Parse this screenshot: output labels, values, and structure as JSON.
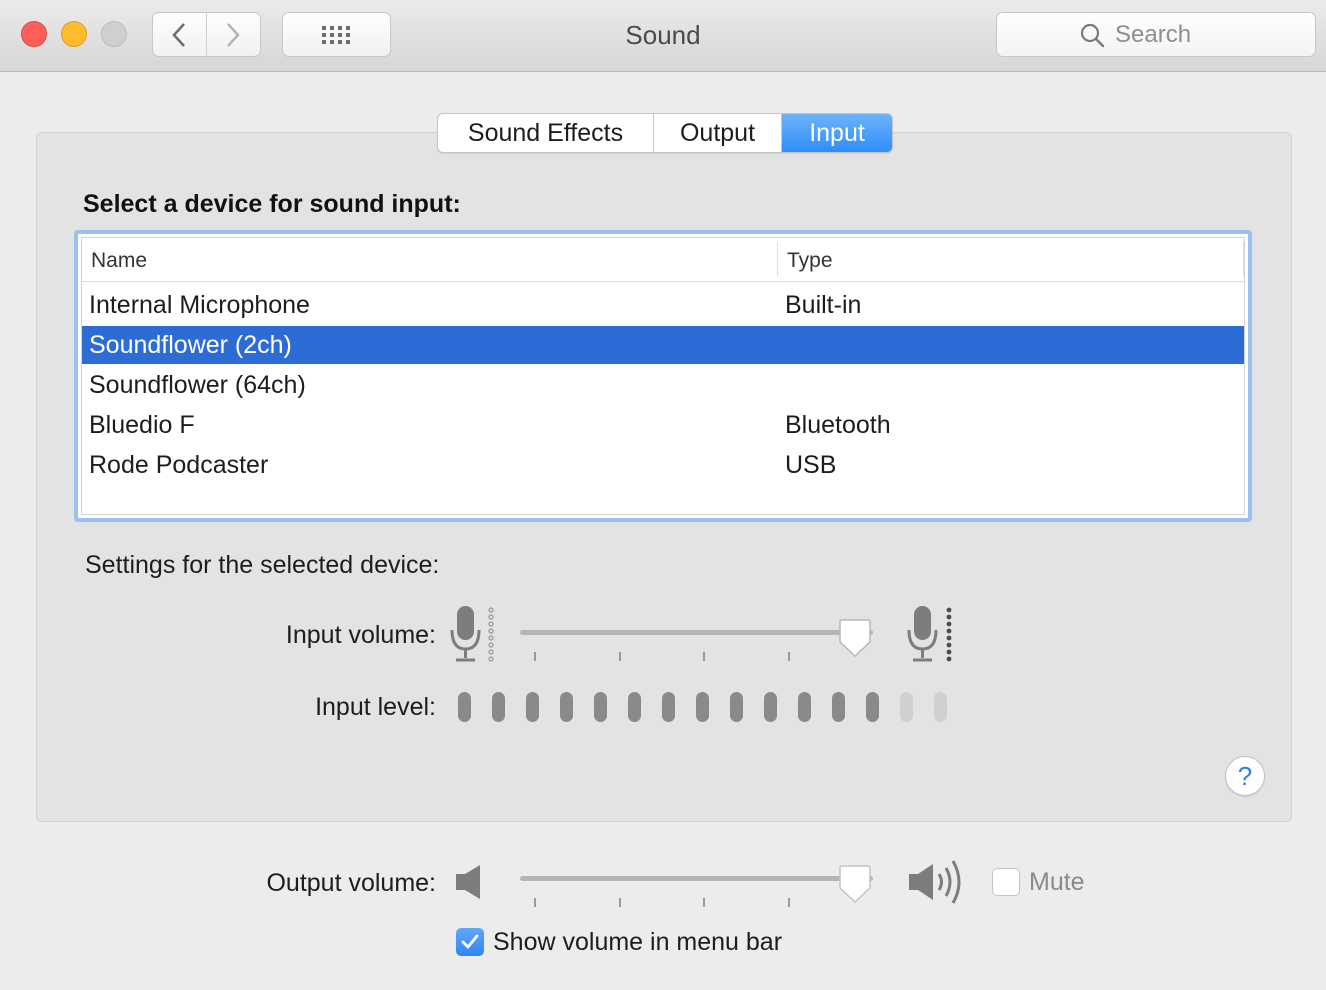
{
  "window": {
    "title": "Sound",
    "search_placeholder": "Search"
  },
  "tabs": [
    {
      "label": "Sound Effects",
      "selected": false
    },
    {
      "label": "Output",
      "selected": false
    },
    {
      "label": "Input",
      "selected": true
    }
  ],
  "input_section": {
    "title": "Select a device for sound input:",
    "columns": [
      "Name",
      "Type"
    ],
    "devices": [
      {
        "name": "Internal Microphone",
        "type": "Built-in",
        "selected": false
      },
      {
        "name": "Soundflower (2ch)",
        "type": "",
        "selected": true
      },
      {
        "name": "Soundflower (64ch)",
        "type": "",
        "selected": false
      },
      {
        "name": "Bluedio F",
        "type": "Bluetooth",
        "selected": false
      },
      {
        "name": "Rode Podcaster",
        "type": "USB",
        "selected": false
      }
    ]
  },
  "settings": {
    "title": "Settings for the selected device:",
    "input_volume_label": "Input volume:",
    "input_volume_fraction": 0.95,
    "input_level_label": "Input level:",
    "input_level_total": 15,
    "input_level_active": 13
  },
  "output": {
    "volume_label": "Output volume:",
    "volume_fraction": 0.95,
    "mute_label": "Mute",
    "mute_checked": false,
    "show_in_menubar_label": "Show volume in menu bar",
    "show_in_menubar_checked": true
  },
  "help_label": "?",
  "colors": {
    "accent": "#2f8ef8",
    "selection": "#2d6cd4",
    "close": "#fc5f57",
    "minimize": "#fdbc2e",
    "zoom_disabled": "#cfcfcf"
  }
}
